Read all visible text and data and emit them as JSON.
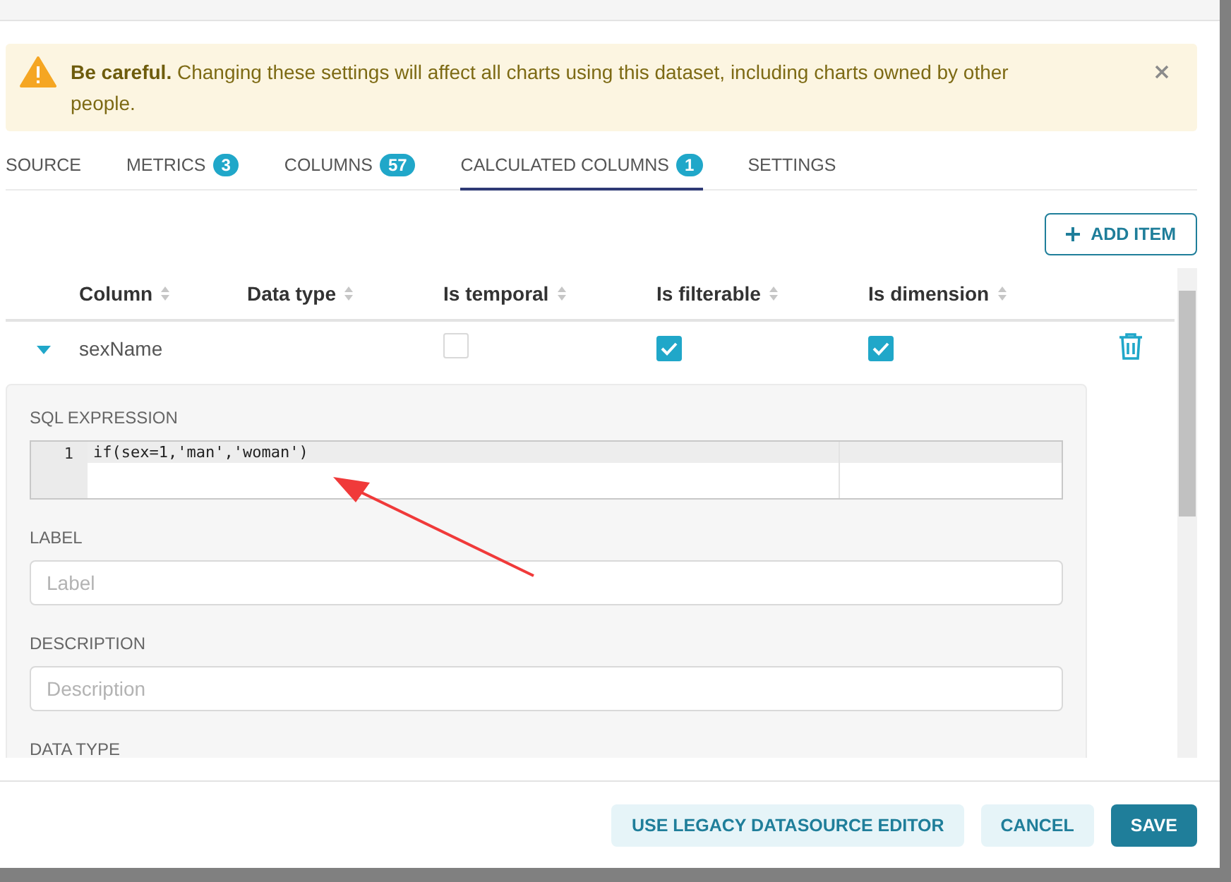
{
  "alert": {
    "text": "**Be careful.** Changing these settings will affect all charts using this dataset, including charts owned by other people."
  },
  "tabs": [
    {
      "label": "SOURCE",
      "selected": false
    },
    {
      "label": "METRICS",
      "count": "3",
      "selected": false
    },
    {
      "label": "COLUMNS",
      "count": "57",
      "selected": false
    },
    {
      "label": "CALCULATED COLUMNS",
      "count": "1",
      "selected": true
    },
    {
      "label": "SETTINGS",
      "selected": false
    }
  ],
  "add_button": "ADD ITEM",
  "table": {
    "columns": [
      "Column",
      "Data type",
      "Is temporal",
      "Is filterable",
      "Is dimension"
    ],
    "rows": [
      {
        "column": "sexName",
        "expanded": true,
        "is_temporal": false,
        "is_filterable": true,
        "is_dimension": true,
        "details": {
          "sql_label": "SQL EXPRESSION",
          "line_number": "1",
          "sql": "if(sex=1,'man','woman')",
          "label_label": "LABEL",
          "label_placeholder": "Label",
          "description_label": "DESCRIPTION",
          "description_placeholder": "Description",
          "data_type_label": "DATA TYPE"
        }
      }
    ]
  },
  "footer": {
    "buttons": [
      {
        "label": "USE LEGACY DATASOURCE EDITOR",
        "kind": "secondary"
      },
      {
        "label": "CANCEL",
        "kind": "secondary"
      },
      {
        "label": "SAVE",
        "kind": "primary"
      }
    ]
  }
}
